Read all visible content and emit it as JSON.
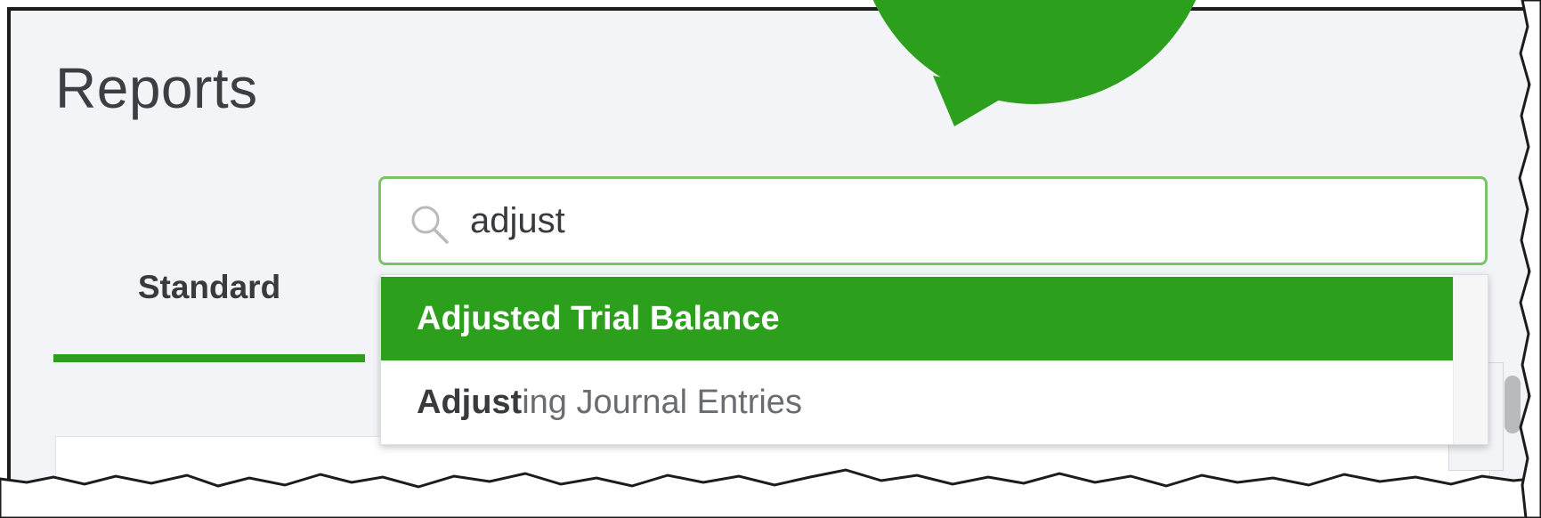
{
  "page": {
    "title": "Reports"
  },
  "tabs": [
    {
      "label": "Standard",
      "active": true
    }
  ],
  "search": {
    "value": "adjust",
    "icon": "search-icon"
  },
  "dropdown": {
    "items": [
      {
        "match": "Adjusted Trial Balance",
        "rest": "",
        "highlighted": true
      },
      {
        "match": "Adjust",
        "rest": "ing Journal Entries",
        "highlighted": false
      }
    ]
  },
  "colors": {
    "accent": "#2ca01c",
    "search_border": "#7dc36a",
    "background": "#f3f4f7",
    "text": "#393a3d"
  }
}
